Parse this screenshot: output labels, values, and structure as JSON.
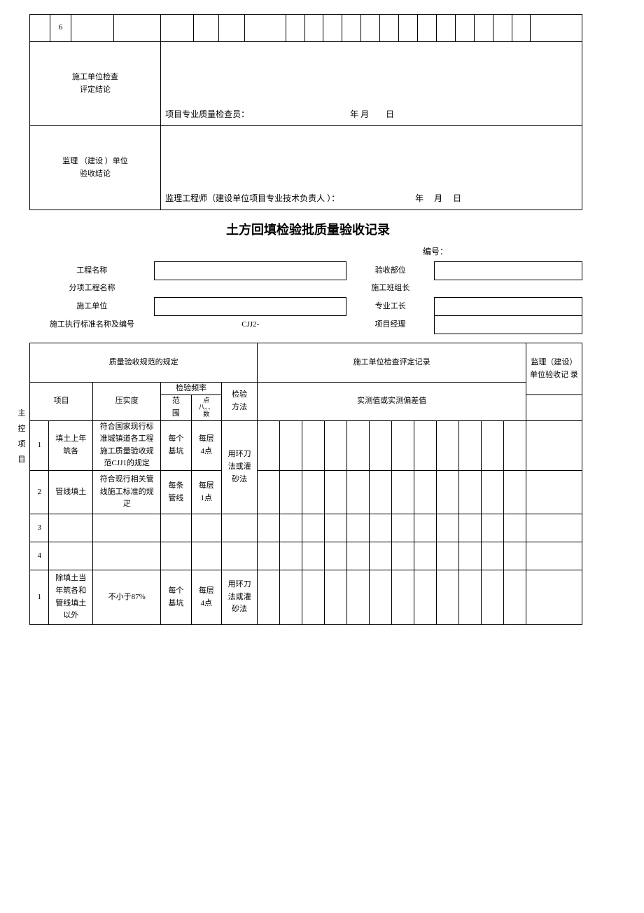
{
  "top": {
    "row_num": "6",
    "c1_label": "施工单位检查\n评定结论",
    "c1_sig": "项目专业质量检查员：            年 月  日",
    "c2_label": "监理 （建设 ）单位\n验收结论",
    "c2_sig": "监理工程师（建设单位项目专业技术负责人 ）：         年  月  日"
  },
  "title": "土方回填检验批质量验收记录",
  "bianhao_label": "编号：",
  "info": {
    "l1": "工程名称",
    "r1": "验收部位",
    "l2": "分项工程名称",
    "r2": "施工班组长",
    "l3": "施工单位",
    "r3": "专业工长",
    "l4": "施工执行标准名称及编号",
    "l4v": "CJJ2-",
    "r4": "项目经理"
  },
  "hdr": {
    "spec": "质量验收规范的规定",
    "rec": "施工单位检查评定记录",
    "sup": "监理（建设）\n单位验收记 录",
    "item": "项目",
    "yashi": "压实度",
    "pinlv": "检验频率",
    "fan": "范\n围",
    "dian": "点\n八、、\n数",
    "fangfa": "检验\n方法",
    "shice": "实测值或实测偏差值"
  },
  "side": {
    "zhu": "主\n控\n项\n目"
  },
  "rows": {
    "a1": {
      "n": "1",
      "item": "填土上年\n筑各",
      "y": "符合国家现行标\n准城镇道各工程\n施工质量验收规\n范CJJ1的规定",
      "f": "每个\n基坑",
      "d": "每层\n4点",
      "m": "用环刀\n法或灌\n砂法"
    },
    "a2": {
      "n": "2",
      "item": "管线填土",
      "y": "符合现行相关管\n线施工标准的规\n疋",
      "f": "每条\n管线",
      "d": "每层\n1点"
    },
    "a3": {
      "n": "3"
    },
    "a4": {
      "n": "4"
    },
    "b1": {
      "n": "1",
      "item": "除填土当\n年筑各和\n管线填土\n以外",
      "y": "不小于87%",
      "f": "每个\n基坑",
      "d": "每层\n4点",
      "m": "用环刀\n法或灌\n砂法"
    }
  }
}
